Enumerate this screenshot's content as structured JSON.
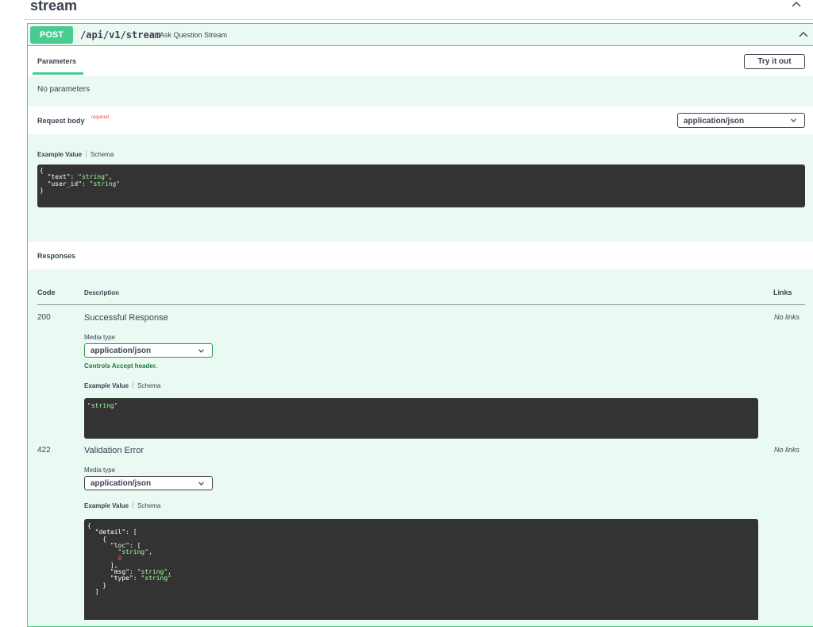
{
  "tag": {
    "title": "stream"
  },
  "operation": {
    "method": "POST",
    "path": "/api/v1/stream",
    "summary": "Ask Question Stream"
  },
  "parameters": {
    "tab_label": "Parameters",
    "try_it_out_label": "Try it out",
    "empty_text": "No parameters"
  },
  "request_body": {
    "label": "Request body",
    "required_label": "required",
    "content_type": "application/json",
    "example_tab": "Example Value",
    "schema_tab": "Schema",
    "example_lines": [
      {
        "pre": "{",
        "str": "",
        "post": ""
      },
      {
        "pre": "  \"text\": ",
        "str": "\"string\"",
        "post": ","
      },
      {
        "pre": "  \"user_id\": ",
        "str": "\"string\"",
        "post": ""
      },
      {
        "pre": "}",
        "str": "",
        "post": ""
      }
    ]
  },
  "responses": {
    "label": "Responses",
    "columns": {
      "code": "Code",
      "description": "Description",
      "links": "Links"
    },
    "items": [
      {
        "code": "200",
        "description": "Successful Response",
        "links": "No links",
        "media_type_label": "Media type",
        "media_type": "application/json",
        "accept_hint": "Controls Accept header.",
        "example_tab": "Example Value",
        "schema_tab": "Schema",
        "example": "\"string\""
      },
      {
        "code": "422",
        "description": "Validation Error",
        "links": "No links",
        "media_type_label": "Media type",
        "media_type": "application/json",
        "example_tab": "Example Value",
        "schema_tab": "Schema",
        "example_lines": [
          {
            "pre": "{",
            "str": "",
            "post": ""
          },
          {
            "pre": "  \"detail\": [",
            "str": "",
            "post": ""
          },
          {
            "pre": "    {",
            "str": "",
            "post": ""
          },
          {
            "pre": "      \"loc\": [",
            "str": "",
            "post": ""
          },
          {
            "pre": "        ",
            "str": "\"string\"",
            "post": ","
          },
          {
            "pre": "        ",
            "num": "0",
            "post": ""
          },
          {
            "pre": "      ],",
            "str": "",
            "post": ""
          },
          {
            "pre": "      \"msg\": ",
            "str": "\"string\"",
            "post": ","
          },
          {
            "pre": "      \"type\": ",
            "str": "\"string\"",
            "post": ""
          },
          {
            "pre": "    }",
            "str": "",
            "post": ""
          },
          {
            "pre": "  ]",
            "str": "",
            "post": ""
          }
        ]
      }
    ]
  },
  "icons": {
    "collapse": "chevron-up-icon",
    "dropdown": "chevron-down-icon"
  },
  "colors": {
    "post_accent": "#49cc90",
    "post_bg": "#ebf9f3",
    "code_bg": "#333333",
    "code_string": "#a2fca2",
    "code_number": "#d36363",
    "required": "#f93e3e"
  }
}
